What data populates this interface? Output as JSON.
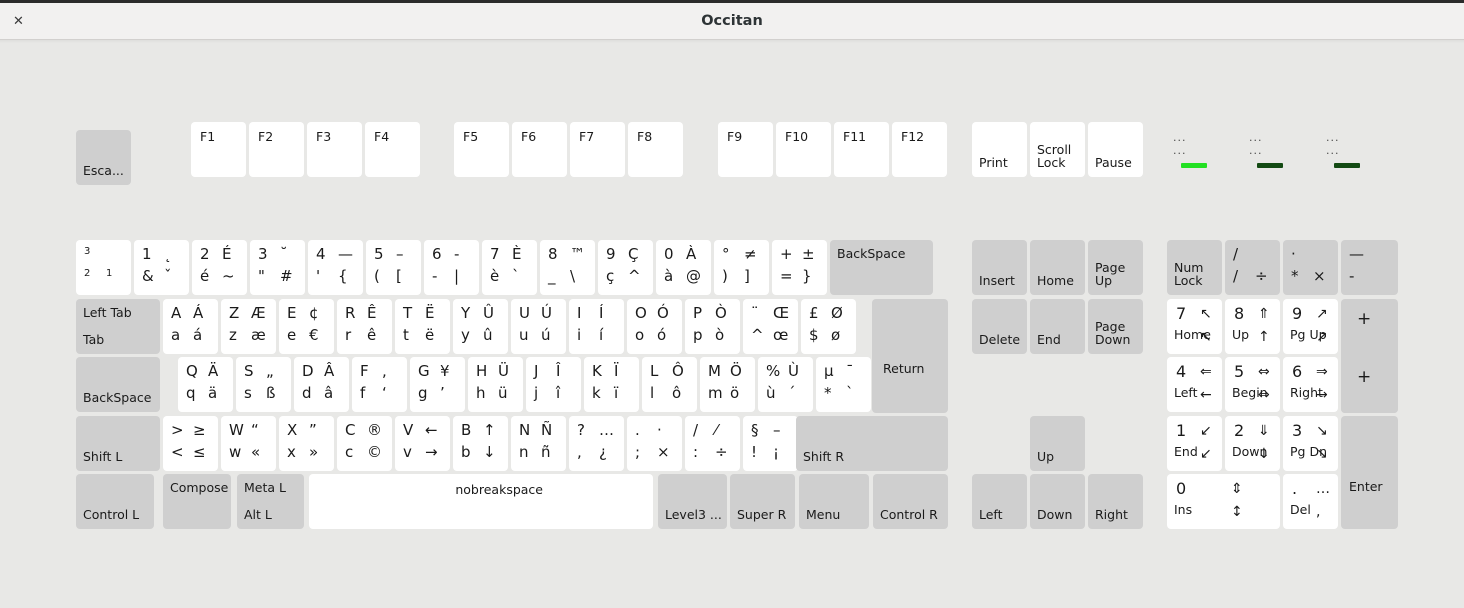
{
  "window": {
    "title": "Occitan",
    "close_icon": "close-icon",
    "close_glyph": "✕"
  },
  "colors": {
    "background": "#e8e8e6",
    "key_normal": "#ffffff",
    "key_modifier": "#cfcfcf",
    "titlebar": "#f2f1f0",
    "led_on": "#22e022",
    "led_off": "#134a13",
    "text": "#1a1a1a"
  },
  "function_row": {
    "escape": {
      "name": "Esca...",
      "gray": true
    },
    "fkeys": [
      "F1",
      "F2",
      "F3",
      "F4",
      "F5",
      "F6",
      "F7",
      "F8",
      "F9",
      "F10",
      "F11",
      "F12"
    ],
    "system": [
      "Print",
      "Scroll Lock",
      "Pause"
    ],
    "leds": [
      {
        "top": "...",
        "bottom": "...",
        "state": "on"
      },
      {
        "top": "...",
        "bottom": "...",
        "state": "off"
      },
      {
        "top": "...",
        "bottom": "...",
        "state": "off"
      }
    ]
  },
  "number_row": {
    "keys": [
      {
        "tl": "3",
        "tr": "",
        "bl": "2",
        "br": "1",
        "small": true
      },
      {
        "tl": "1",
        "tr": "˛",
        "bl": "&",
        "br": "ˇ"
      },
      {
        "tl": "2",
        "tr": "É",
        "bl": "é",
        "br": "~"
      },
      {
        "tl": "3",
        "tr": "˘",
        "bl": "\"",
        "br": "#"
      },
      {
        "tl": "4",
        "tr": "—",
        "bl": "'",
        "br": "{"
      },
      {
        "tl": "5",
        "tr": "–",
        "bl": "(",
        "br": "["
      },
      {
        "tl": "6",
        "tr": "-",
        "bl": "-",
        "br": "|"
      },
      {
        "tl": "7",
        "tr": "È",
        "bl": "è",
        "br": "`"
      },
      {
        "tl": "8",
        "tr": "™",
        "bl": "_",
        "br": "\\"
      },
      {
        "tl": "9",
        "tr": "Ç",
        "bl": "ç",
        "br": "^"
      },
      {
        "tl": "0",
        "tr": "À",
        "bl": "à",
        "br": "@"
      },
      {
        "tl": "°",
        "tr": "≠",
        "bl": ")",
        "br": "]"
      },
      {
        "tl": "+",
        "tr": "±",
        "bl": "=",
        "br": "}"
      }
    ],
    "backspace": "BackSpace"
  },
  "tab_row": {
    "tab": {
      "top": "Left Tab",
      "bottom": "Tab"
    },
    "keys": [
      {
        "tl": "A",
        "tr": "Á",
        "bl": "a",
        "br": "á"
      },
      {
        "tl": "Z",
        "tr": "Æ",
        "bl": "z",
        "br": "æ"
      },
      {
        "tl": "E",
        "tr": "¢",
        "bl": "e",
        "br": "€"
      },
      {
        "tl": "R",
        "tr": "Ê",
        "bl": "r",
        "br": "ê"
      },
      {
        "tl": "T",
        "tr": "Ë",
        "bl": "t",
        "br": "ë"
      },
      {
        "tl": "Y",
        "tr": "Û",
        "bl": "y",
        "br": "û"
      },
      {
        "tl": "U",
        "tr": "Ú",
        "bl": "u",
        "br": "ú"
      },
      {
        "tl": "I",
        "tr": "Í",
        "bl": "i",
        "br": "í"
      },
      {
        "tl": "O",
        "tr": "Ó",
        "bl": "o",
        "br": "ó"
      },
      {
        "tl": "P",
        "tr": "Ò",
        "bl": "p",
        "br": "ò"
      },
      {
        "tl": "¨",
        "tr": "Œ",
        "bl": "^",
        "br": "œ"
      },
      {
        "tl": "£",
        "tr": "Ø",
        "bl": "$",
        "br": "ø"
      }
    ],
    "return": "Return"
  },
  "home_row": {
    "capslock": "BackSpace",
    "keys": [
      {
        "tl": "Q",
        "tr": "Ä",
        "bl": "q",
        "br": "ä"
      },
      {
        "tl": "S",
        "tr": "„",
        "bl": "s",
        "br": "ß"
      },
      {
        "tl": "D",
        "tr": "Â",
        "bl": "d",
        "br": "â"
      },
      {
        "tl": "F",
        "tr": ",",
        "bl": "f",
        "br": "‘"
      },
      {
        "tl": "G",
        "tr": "¥",
        "bl": "g",
        "br": "’"
      },
      {
        "tl": "H",
        "tr": "Ü",
        "bl": "h",
        "br": "ü"
      },
      {
        "tl": "J",
        "tr": "Î",
        "bl": "j",
        "br": "î"
      },
      {
        "tl": "K",
        "tr": "Ï",
        "bl": "k",
        "br": "ï"
      },
      {
        "tl": "L",
        "tr": "Ô",
        "bl": "l",
        "br": "ô"
      },
      {
        "tl": "M",
        "tr": "Ö",
        "bl": "m",
        "br": "ö"
      },
      {
        "tl": "%",
        "tr": "Ù",
        "bl": "ù",
        "br": "´"
      },
      {
        "tl": "µ",
        "tr": "¯",
        "bl": "*",
        "br": "`"
      }
    ]
  },
  "shift_row": {
    "shift_left": "Shift L",
    "shift_right": "Shift R",
    "keys": [
      {
        "tl": ">",
        "tr": "≥",
        "bl": "<",
        "br": "≤"
      },
      {
        "tl": "W",
        "tr": "“",
        "bl": "w",
        "br": "«"
      },
      {
        "tl": "X",
        "tr": "”",
        "bl": "x",
        "br": "»"
      },
      {
        "tl": "C",
        "tr": "®",
        "bl": "c",
        "br": "©"
      },
      {
        "tl": "V",
        "tr": "←",
        "bl": "v",
        "br": "→"
      },
      {
        "tl": "B",
        "tr": "↑",
        "bl": "b",
        "br": "↓"
      },
      {
        "tl": "N",
        "tr": "Ñ",
        "bl": "n",
        "br": "ñ"
      },
      {
        "tl": "?",
        "tr": "…",
        "bl": ",",
        "br": "¿"
      },
      {
        "tl": ".",
        "tr": "·",
        "bl": ";",
        "br": "×"
      },
      {
        "tl": "/",
        "tr": "⁄",
        "bl": ":",
        "br": "÷"
      },
      {
        "tl": "§",
        "tr": "–",
        "bl": "!",
        "br": "¡"
      }
    ]
  },
  "bottom_row": {
    "control_left": "Control L",
    "compose": "Compose",
    "meta": {
      "top": "Meta L",
      "bottom": "Alt L"
    },
    "space": "nobreakspace",
    "level3": "Level3 ...",
    "super_right": "Super R",
    "menu": "Menu",
    "control_right": "Control R"
  },
  "nav_cluster": {
    "keys": [
      "Insert",
      "Home",
      "Page Up",
      "Delete",
      "End",
      "Page Down"
    ],
    "arrows": {
      "up": "Up",
      "left": "Left",
      "down": "Down",
      "right": "Right"
    }
  },
  "numpad": {
    "numlock": "Num Lock",
    "divide": {
      "tl": "/",
      "bl": "/",
      "br": "÷"
    },
    "multiply": {
      "tl": "·",
      "bl": "*",
      "br": "×"
    },
    "minus": {
      "tl": "—",
      "bl": "-"
    },
    "plus": "+",
    "enter": "Enter",
    "keys": [
      {
        "num": "7",
        "sym": "↖",
        "name": "Home",
        "arrow": "↖"
      },
      {
        "num": "8",
        "sym": "⇑",
        "name": "Up",
        "arrow": "↑"
      },
      {
        "num": "9",
        "sym": "↗",
        "name": "Pg Up",
        "arrow": "↗"
      },
      {
        "num": "4",
        "sym": "⇐",
        "name": "Left",
        "arrow": "←"
      },
      {
        "num": "5",
        "sym": "⇔",
        "name": "Begin",
        "arrow": "⇔"
      },
      {
        "num": "6",
        "sym": "⇒",
        "name": "Right",
        "arrow": "→"
      },
      {
        "num": "1",
        "sym": "↙",
        "name": "End",
        "arrow": "↙"
      },
      {
        "num": "2",
        "sym": "⇓",
        "name": "Down",
        "arrow": "↓"
      },
      {
        "num": "3",
        "sym": "↘",
        "name": "Pg Dn",
        "arrow": "↘"
      },
      {
        "num": "0",
        "sym": "⇕",
        "name": "Ins",
        "arrow": "↕"
      },
      {
        "num": ".",
        "sym": "…",
        "name": "Del",
        "arrow": ","
      }
    ]
  }
}
